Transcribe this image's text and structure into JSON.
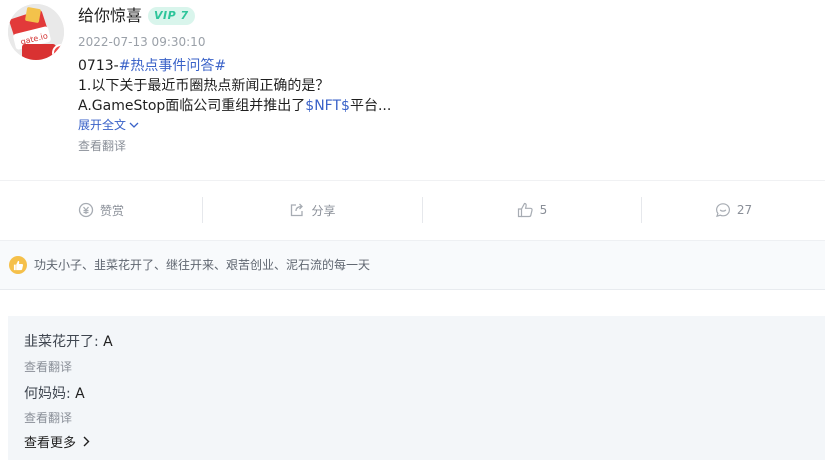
{
  "post": {
    "avatar_icon": "gate-io-red-envelope",
    "author": "给你惊喜",
    "vip_badge": "VIP 7",
    "timestamp": "2022-07-13 09:30:10",
    "line1_prefix": "0713-",
    "line1_tag": "#热点事件问答#",
    "line2": "1.以下关于最近币圈热点新闻正确的是？",
    "line3_prefix": "A.GameStop面临公司重组并推出了",
    "line3_tag": "$NFT$",
    "line3_suffix": "平台...",
    "expand_label": "展开全文",
    "translate_label": "查看翻译"
  },
  "actions": {
    "reward_label": "赞赏",
    "share_label": "分享",
    "like_count": "5",
    "comment_count": "27"
  },
  "likes": {
    "names": "功夫小子、韭菜花开了、继往开来、艰苦创业、泥石流的每一天"
  },
  "comments": [
    {
      "author": "韭菜花开了:",
      "text": "A",
      "translate_label": "查看翻译"
    },
    {
      "author": "何妈妈:",
      "text": "A",
      "translate_label": "查看翻译"
    }
  ],
  "more_label": "查看更多",
  "colors": {
    "link": "#3a62c8",
    "vip_bg": "#d9f5ec",
    "vip_text": "#2dc59a",
    "like_badge": "#f5c04a"
  }
}
